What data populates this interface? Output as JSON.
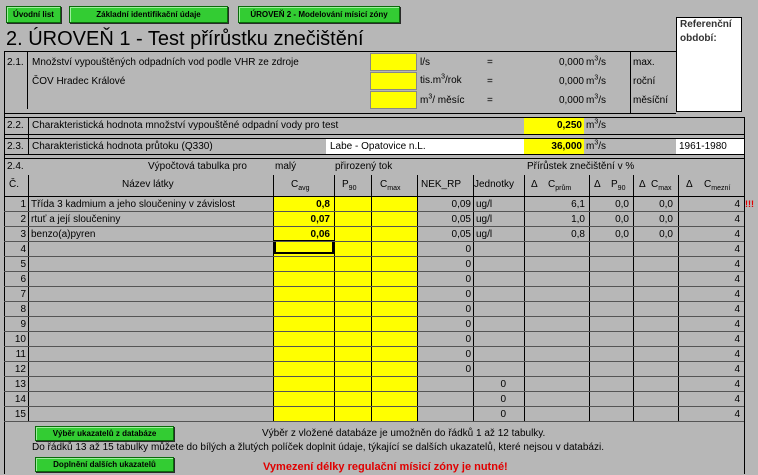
{
  "nav": {
    "btn_uvodni": "Úvodní list",
    "btn_zakladni": "Základní identifikační údaje",
    "btn_uroven2": "ÚROVEŇ 2 - Modelování mísicí zóny"
  },
  "title": "2. ÚROVEŇ 1 - Test přírůstku znečištění",
  "ref": {
    "line1": "Referenční",
    "line2": "období:",
    "years": "1961-1980"
  },
  "s21": {
    "num": "2.1.",
    "text1": "Množství vypouštěných odpadních vod podle VHR ze zdroje",
    "text2": "ČOV Hradec Králové",
    "u1": "l/s",
    "u2a": "tis.m",
    "u2b": "/rok",
    "u3a": "m",
    "u3b": "/ měsíc",
    "sup3": "3",
    "eq": "=",
    "v1": "0,000",
    "v2": "0,000",
    "v3": "0,000",
    "vu_a": "m",
    "vu_b": "/s",
    "lab1": "max.",
    "lab2": "roční",
    "lab3": "měsíční"
  },
  "s22": {
    "num": "2.2.",
    "text": "Charakteristická hodnota množství vypouštěné odpadní vody pro test",
    "value": "0,250",
    "ua": "m",
    "ub": "/s"
  },
  "s23": {
    "num": "2.3.",
    "text": "Charakteristická hodnota průtoku  (Q330)",
    "river": "Labe - Opatovice n.L.",
    "value": "36,000",
    "ua": "m",
    "ub": "/s"
  },
  "s24": {
    "num": "2.4.",
    "calc_head": "Výpočtová tabulka pro",
    "calc_small": "malý",
    "calc_flow": "přirozený tok",
    "increment_head": "Přírůstek znečištění v %",
    "col_c": "Č.",
    "col_name": "Název látky",
    "col_cavg": "C",
    "col_cavg_sub": "avg",
    "col_p90": "P",
    "col_p90_sub": "90",
    "col_cmax": "C",
    "col_cmax_sub": "max",
    "col_nek": "NEK_RP",
    "col_units": "Jednotky",
    "delta": "Δ",
    "col_cprum": "C",
    "col_cprum_sub": "prům",
    "col_dp90": "P",
    "col_dp90_sub": "90",
    "col_dcmax": "C",
    "col_dcmax_sub": "max",
    "col_cmezni": "C",
    "col_cmezni_sub": "mezní"
  },
  "rows": [
    {
      "n": "1",
      "name": "Třída 3 kadmium a jeho sloučeniny v závislost",
      "cavg": "0,8",
      "nek": "0,09",
      "unit": "ug/l",
      "cprum": "6,1",
      "p90": "0,0",
      "cmax": "0,0",
      "mezni": "4",
      "flag": "!!!"
    },
    {
      "n": "2",
      "name": "rtuť a její sloučeniny",
      "cavg": "0,07",
      "nek": "0,05",
      "unit": "ug/l",
      "cprum": "1,0",
      "p90": "0,0",
      "cmax": "0,0",
      "mezni": "4",
      "flag": ""
    },
    {
      "n": "3",
      "name": "benzo(a)pyren",
      "cavg": "0,06",
      "nek": "0,05",
      "unit": "ug/l",
      "cprum": "0,8",
      "p90": "0,0",
      "cmax": "0,0",
      "mezni": "4",
      "flag": ""
    },
    {
      "n": "4",
      "name": "",
      "cavg": "",
      "nek": "0",
      "unit": "",
      "cprum": "",
      "p90": "",
      "cmax": "",
      "mezni": "4",
      "flag": ""
    },
    {
      "n": "5",
      "name": "",
      "cavg": "",
      "nek": "0",
      "unit": "",
      "cprum": "",
      "p90": "",
      "cmax": "",
      "mezni": "4",
      "flag": ""
    },
    {
      "n": "6",
      "name": "",
      "cavg": "",
      "nek": "0",
      "unit": "",
      "cprum": "",
      "p90": "",
      "cmax": "",
      "mezni": "4",
      "flag": ""
    },
    {
      "n": "7",
      "name": "",
      "cavg": "",
      "nek": "0",
      "unit": "",
      "cprum": "",
      "p90": "",
      "cmax": "",
      "mezni": "4",
      "flag": ""
    },
    {
      "n": "8",
      "name": "",
      "cavg": "",
      "nek": "0",
      "unit": "",
      "cprum": "",
      "p90": "",
      "cmax": "",
      "mezni": "4",
      "flag": ""
    },
    {
      "n": "9",
      "name": "",
      "cavg": "",
      "nek": "0",
      "unit": "",
      "cprum": "",
      "p90": "",
      "cmax": "",
      "mezni": "4",
      "flag": ""
    },
    {
      "n": "10",
      "name": "",
      "cavg": "",
      "nek": "0",
      "unit": "",
      "cprum": "",
      "p90": "",
      "cmax": "",
      "mezni": "4",
      "flag": ""
    },
    {
      "n": "11",
      "name": "",
      "cavg": "",
      "nek": "0",
      "unit": "",
      "cprum": "",
      "p90": "",
      "cmax": "",
      "mezni": "4",
      "flag": ""
    },
    {
      "n": "12",
      "name": "",
      "cavg": "",
      "nek": "0",
      "unit": "",
      "cprum": "",
      "p90": "",
      "cmax": "",
      "mezni": "4",
      "flag": ""
    },
    {
      "n": "13",
      "name": "",
      "cavg": "",
      "nek": "",
      "unit": "0",
      "cprum": "",
      "p90": "",
      "cmax": "",
      "mezni": "4",
      "flag": ""
    },
    {
      "n": "14",
      "name": "",
      "cavg": "",
      "nek": "",
      "unit": "0",
      "cprum": "",
      "p90": "",
      "cmax": "",
      "mezni": "4",
      "flag": ""
    },
    {
      "n": "15",
      "name": "",
      "cavg": "",
      "nek": "",
      "unit": "0",
      "cprum": "",
      "p90": "",
      "cmax": "",
      "mezni": "4",
      "flag": ""
    }
  ],
  "footer": {
    "btn_db": "Výběr ukazatelů z databáze",
    "btn_more": "Doplnění dalších ukazatelů",
    "note1": "Výběr z vložené databáze je umožněn do řádků 1 až 12 tabulky.",
    "note2": "Do řádků 13 až 15 tabulky můžete do bílých a žlutých políček doplnit údaje,  týkající se dalších ukazatelů, které nejsou v databázi.",
    "warning": "Vymezení délky regulační mísicí zóny   je nutné!"
  },
  "colors": {
    "bg": "#b7b7b7",
    "input": "#ffff00",
    "button": "#33cc33",
    "warning": "#e00000"
  }
}
